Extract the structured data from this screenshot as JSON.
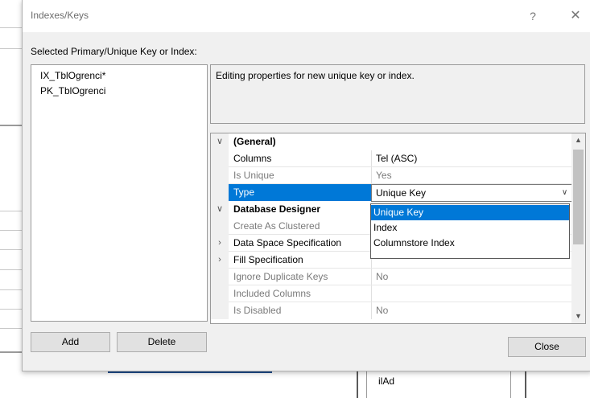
{
  "dialog": {
    "title": "Indexes/Keys",
    "help_glyph": "?",
    "close_glyph": "✕",
    "selected_label": "Selected Primary/Unique Key or Index:",
    "keys": [
      "IX_TblOgrenci*",
      "PK_TblOgrenci"
    ],
    "description": "Editing properties for new unique key or index.",
    "properties": {
      "general_label": "(General)",
      "columns_label": "Columns",
      "columns_value": "Tel (ASC)",
      "is_unique_label": "Is Unique",
      "is_unique_value": "Yes",
      "type_label": "Type",
      "type_value": "Unique Key",
      "db_designer_label": "Database Designer",
      "create_clustered_label": "Create As Clustered",
      "data_space_label": "Data Space Specification",
      "fill_spec_label": "Fill Specification",
      "ignore_dup_label": "Ignore Duplicate Keys",
      "ignore_dup_value": "No",
      "included_cols_label": "Included Columns",
      "is_disabled_label": "Is Disabled",
      "is_disabled_value": "No"
    },
    "type_options": [
      "Unique Key",
      "Index",
      "Columnstore Index"
    ],
    "buttons": {
      "add": "Add",
      "delete": "Delete",
      "close": "Close"
    }
  },
  "background": {
    "table_cell_text": "ilAd"
  }
}
